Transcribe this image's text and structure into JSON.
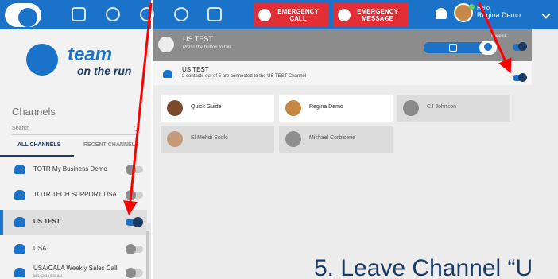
{
  "topbar": {
    "icons": [
      "team-logo-icon",
      "contacts-icon",
      "chat-icon",
      "channels-icon",
      "dashboard-icon",
      "map-icon"
    ],
    "emergency_call": "EMERGENCY\nCALL",
    "emergency_message": "EMERGENCY\nMESSAGE",
    "greeting": "Hello,",
    "user_name": "Regina Demo"
  },
  "sidebar": {
    "brand_line1": "team",
    "brand_line2": "on the run",
    "channels_title": "Channels",
    "search_placeholder": "Search",
    "tabs": [
      "ALL CHANNELS",
      "RECENT CHANNELS"
    ],
    "items": [
      {
        "label": "TOTR My Business Demo",
        "sub": "",
        "on": false
      },
      {
        "label": "TOTR TECH SUPPORT USA",
        "sub": "",
        "on": false
      },
      {
        "label": "US TEST",
        "sub": "",
        "on": true
      },
      {
        "label": "USA",
        "sub": "",
        "on": false
      },
      {
        "label": "USA/CALA Weekly Sales Call",
        "sub": "08/14/2018 9:32 AM",
        "on": false
      }
    ]
  },
  "main": {
    "ptt_title": "US TEST",
    "ptt_subtitle": "Press the button to talk",
    "channel_label": "CHANNEL",
    "status_title": "US TEST",
    "status_subtitle": "2 contacts out of 5 are connected to the US TEST Channel",
    "contacts": [
      {
        "name": "Quick Guide",
        "online": true
      },
      {
        "name": "Regina Demo",
        "online": true
      },
      {
        "name": "CJ Johnson",
        "online": false
      },
      {
        "name": "El Mehdi Sodki",
        "online": false
      },
      {
        "name": "Michael Corbiserie",
        "online": false
      }
    ]
  },
  "caption": "5. Leave Channel “U",
  "colors": {
    "brand_blue": "#1a73c9",
    "brand_navy": "#1a3a63",
    "emergency_red": "#e12f35",
    "arrow_red": "#ff0000"
  }
}
